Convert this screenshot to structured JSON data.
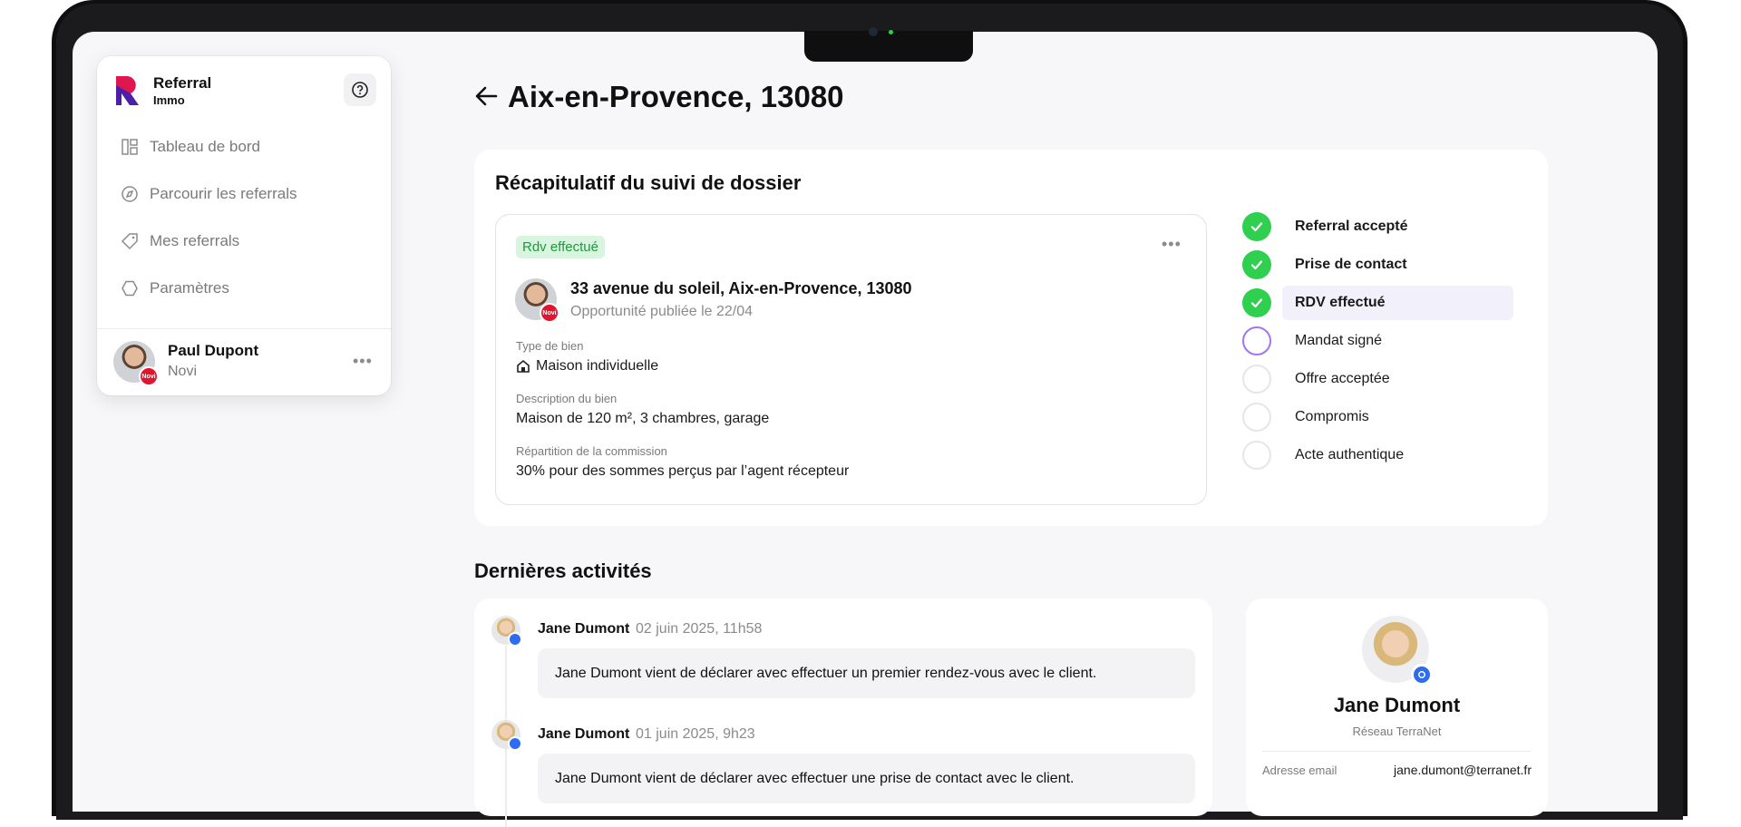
{
  "brand": {
    "name": "Referral",
    "sub": "Immo"
  },
  "nav": [
    {
      "label": "Tableau de bord",
      "icon": "dashboard-icon"
    },
    {
      "label": "Parcourir les referrals",
      "icon": "compass-icon"
    },
    {
      "label": "Mes referrals",
      "icon": "tag-icon"
    },
    {
      "label": "Paramètres",
      "icon": "hexagon-icon"
    }
  ],
  "user": {
    "name": "Paul Dupont",
    "org": "Novi",
    "badge": "Novi"
  },
  "page": {
    "title": "Aix-en-Provence, 13080"
  },
  "recap": {
    "title": "Récapitulatif du suivi de dossier",
    "status": "Rdv effectué",
    "address": "33 avenue du soleil, Aix-en-Provence, 13080",
    "published": "Opportunité publiée le 22/04",
    "fields": [
      {
        "label": "Type de bien",
        "value": "Maison individuelle"
      },
      {
        "label": "Description du bien",
        "value": "Maison de 120 m², 3 chambres, garage"
      },
      {
        "label": "Répartition de la commission",
        "value": "30% pour des sommes perçus par l’agent récepteur"
      }
    ],
    "steps": [
      {
        "label": "Referral accepté",
        "state": "done"
      },
      {
        "label": "Prise de contact",
        "state": "done"
      },
      {
        "label": "RDV effectué",
        "state": "done"
      },
      {
        "label": "Mandat signé",
        "state": "current"
      },
      {
        "label": "Offre acceptée",
        "state": "todo"
      },
      {
        "label": "Compromis",
        "state": "todo"
      },
      {
        "label": "Acte authentique",
        "state": "todo"
      }
    ]
  },
  "activities": {
    "title": "Dernières activités",
    "items": [
      {
        "author": "Jane Dumont",
        "date": "02 juin 2025, 11h58",
        "message": "Jane Dumont vient de déclarer avec effectuer un premier rendez-vous avec le client."
      },
      {
        "author": "Jane Dumont",
        "date": "01 juin 2025, 9h23",
        "message": "Jane Dumont vient de déclarer avec effectuer une prise de contact avec le client."
      }
    ]
  },
  "contact": {
    "name": "Jane Dumont",
    "network": "Réseau TerraNet",
    "email_label": "Adresse email",
    "email": "jane.dumont@terranet.fr"
  },
  "colors": {
    "accent": "#a276f2",
    "success": "#2fcf4f",
    "danger": "#e1162e",
    "brand": "#2d6cf0"
  }
}
